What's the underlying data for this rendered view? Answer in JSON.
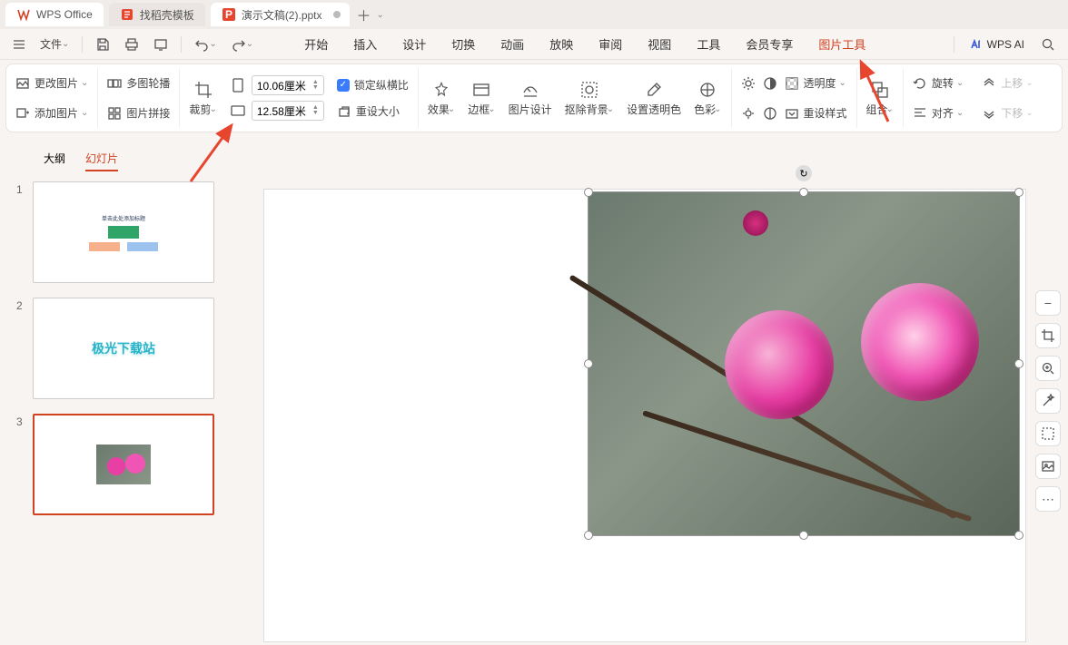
{
  "tabs": {
    "app": "WPS Office",
    "docai": "找稻壳模板",
    "file": "演示文稿(2).pptx"
  },
  "menubar": {
    "file": "文件",
    "items": [
      "开始",
      "插入",
      "设计",
      "切换",
      "动画",
      "放映",
      "审阅",
      "视图",
      "工具",
      "会员专享"
    ],
    "active": "图片工具",
    "ai": "WPS AI"
  },
  "ribbon": {
    "change_pic": "更改图片",
    "multi_select": "多图轮播",
    "add_pic": "添加图片",
    "pic_join": "图片拼接",
    "crop": "裁剪",
    "width_val": "10.06厘米",
    "height_val": "12.58厘米",
    "lock_ratio": "锁定纵横比",
    "reset_size": "重设大小",
    "effect": "效果",
    "border": "边框",
    "pic_design": "图片设计",
    "remove_bg": "抠除背景",
    "set_trans": "设置透明色",
    "color": "色彩",
    "trans": "透明度",
    "reset_style": "重设样式",
    "combine": "组合",
    "rotate": "旋转",
    "align": "对齐",
    "up_layer": "上移",
    "down_layer": "下移"
  },
  "outline": {
    "tab1": "大纲",
    "tab2": "幻灯片"
  },
  "slides": {
    "nums": [
      "1",
      "2",
      "3"
    ],
    "s1_title": "单击此处添加标题",
    "s2_text": "极光下载站"
  }
}
